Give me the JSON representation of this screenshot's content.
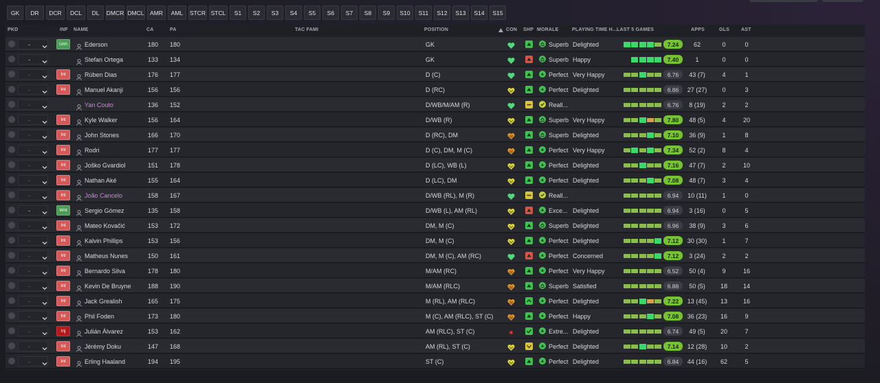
{
  "position_filters": [
    "GK",
    "DR",
    "DCR",
    "DCL",
    "DL",
    "DMCR",
    "DMCL",
    "AMR",
    "AML",
    "STCR",
    "STCL",
    "S1",
    "S2",
    "S3",
    "S4",
    "S5",
    "S6",
    "S7",
    "S8",
    "S9",
    "S10",
    "S11",
    "S12",
    "S13",
    "S14",
    "S15"
  ],
  "columns": {
    "pkd": "PKD",
    "inf": "INF",
    "name": "NAME",
    "ca": "CA",
    "pa": "PA",
    "tac": "TAC FAMI",
    "position": "POSITION",
    "sort_icon": "sort-ascending-icon",
    "con": "CON",
    "shp": "SHP",
    "morale": "MORALE",
    "playing_time": "PLAYING TIME H...",
    "last5": "LAST 5 GAMES",
    "apps": "APPS",
    "gls": "GLS",
    "ast": "AST"
  },
  "colors": {
    "accent_green": "#76c331",
    "heart_green": "#4fd97a",
    "heart_yellow": "#d8d43a",
    "heart_orange": "#e0962e",
    "int_red": "#d45a5a",
    "loan_purple": "#c88bd2"
  },
  "players": [
    {
      "pkd": "-",
      "inf": "Unh",
      "name": "Ederson",
      "loan": false,
      "ca": "180",
      "pa": "180",
      "position": "GK",
      "con": "green",
      "shp": "green",
      "shp_icon": "up",
      "morale_level": "superb",
      "morale": "Superb",
      "playing_time": "Delighted",
      "last5": [
        2,
        2,
        2,
        2,
        1
      ],
      "rating": "7.24",
      "rating_hi": true,
      "apps": "62",
      "gls": "0",
      "ast": "0"
    },
    {
      "pkd": "-",
      "inf": "",
      "name": "Stefan Ortega",
      "loan": false,
      "ca": "133",
      "pa": "134",
      "position": "GK",
      "con": "green",
      "shp": "red",
      "shp_icon": "up",
      "morale_level": "superb",
      "morale": "Superb",
      "playing_time": "Happy",
      "last5": [
        0,
        2,
        2,
        2,
        2
      ],
      "rating": "7.40",
      "rating_hi": true,
      "apps": "1",
      "gls": "0",
      "ast": "0"
    },
    {
      "pkd": "-",
      "inf": "Int",
      "name": "Rúben Dias",
      "loan": false,
      "ca": "176",
      "pa": "177",
      "position": "D (C)",
      "con": "green",
      "shp": "green",
      "shp_icon": "up",
      "morale_level": "perfect",
      "morale": "Perfect",
      "playing_time": "Very Happy",
      "last5": [
        1,
        1,
        2,
        1,
        1
      ],
      "rating": "6.76",
      "rating_hi": false,
      "apps": "43 (7)",
      "gls": "4",
      "ast": "1"
    },
    {
      "pkd": "-",
      "inf": "Int",
      "name": "Manuel Akanji",
      "loan": false,
      "ca": "156",
      "pa": "156",
      "position": "D (RC)",
      "con": "yellow",
      "shp": "green",
      "shp_icon": "up",
      "morale_level": "perfect",
      "morale": "Perfect",
      "playing_time": "Delighted",
      "last5": [
        1,
        1,
        1,
        1,
        1
      ],
      "rating": "6.86",
      "rating_hi": false,
      "apps": "27 (27)",
      "gls": "0",
      "ast": "3"
    },
    {
      "pkd": "-",
      "inf": "",
      "name": "Yan Couto",
      "loan": true,
      "ca": "136",
      "pa": "152",
      "position": "D/WB/M/AM (R)",
      "con": "green",
      "shp": "yellow",
      "shp_icon": "dash",
      "morale_level": "good",
      "morale": "Reall...",
      "playing_time": "",
      "last5": [
        1,
        1,
        1,
        1,
        1
      ],
      "rating": "6.76",
      "rating_hi": false,
      "apps": "8 (19)",
      "gls": "2",
      "ast": "2"
    },
    {
      "pkd": "-",
      "inf": "Int",
      "name": "Kyle Walker",
      "loan": false,
      "ca": "156",
      "pa": "164",
      "position": "D/WB (R)",
      "con": "yellow",
      "shp": "green",
      "shp_icon": "up",
      "morale_level": "superb",
      "morale": "Superb",
      "playing_time": "Very Happy",
      "last5": [
        1,
        1,
        2,
        3,
        1
      ],
      "rating": "7.80",
      "rating_hi": true,
      "apps": "48 (5)",
      "gls": "4",
      "ast": "20"
    },
    {
      "pkd": "-",
      "inf": "Int",
      "name": "John Stones",
      "loan": false,
      "ca": "166",
      "pa": "170",
      "position": "D (RC), DM",
      "con": "orange",
      "shp": "green",
      "shp_icon": "up",
      "morale_level": "superb",
      "morale": "Superb",
      "playing_time": "Delighted",
      "last5": [
        1,
        1,
        1,
        2,
        1
      ],
      "rating": "7.10",
      "rating_hi": true,
      "apps": "36 (9)",
      "gls": "1",
      "ast": "8"
    },
    {
      "pkd": "-",
      "inf": "Int",
      "name": "Rodri",
      "loan": false,
      "ca": "177",
      "pa": "177",
      "position": "D (C), DM, M (C)",
      "con": "orange",
      "shp": "green",
      "shp_icon": "up",
      "morale_level": "perfect",
      "morale": "Perfect",
      "playing_time": "Very Happy",
      "last5": [
        1,
        2,
        1,
        2,
        1
      ],
      "rating": "7.34",
      "rating_hi": true,
      "apps": "52 (2)",
      "gls": "8",
      "ast": "4"
    },
    {
      "pkd": "-",
      "inf": "Int",
      "name": "Joško Gvardiol",
      "loan": false,
      "ca": "151",
      "pa": "178",
      "position": "D (LC), WB (L)",
      "con": "yellow",
      "shp": "green",
      "shp_icon": "up",
      "morale_level": "perfect",
      "morale": "Perfect",
      "playing_time": "Delighted",
      "last5": [
        1,
        1,
        2,
        1,
        1
      ],
      "rating": "7.16",
      "rating_hi": true,
      "apps": "47 (7)",
      "gls": "2",
      "ast": "10"
    },
    {
      "pkd": "-",
      "inf": "Int",
      "name": "Nathan Aké",
      "loan": false,
      "ca": "155",
      "pa": "164",
      "position": "D (LC), DM",
      "con": "yellow",
      "shp": "green",
      "shp_icon": "up",
      "morale_level": "perfect",
      "morale": "Perfect",
      "playing_time": "Delighted",
      "last5": [
        1,
        1,
        1,
        2,
        1
      ],
      "rating": "7.08",
      "rating_hi": true,
      "apps": "48 (7)",
      "gls": "3",
      "ast": "4"
    },
    {
      "pkd": "-",
      "inf": "Int",
      "name": "João Cancelo",
      "loan": true,
      "ca": "158",
      "pa": "167",
      "position": "D/WB (RL), M (R)",
      "con": "green",
      "shp": "yellow",
      "shp_icon": "dash",
      "morale_level": "good",
      "morale": "Reall...",
      "playing_time": "",
      "last5": [
        1,
        1,
        1,
        1,
        1
      ],
      "rating": "6.94",
      "rating_hi": false,
      "apps": "10 (11)",
      "gls": "1",
      "ast": "0"
    },
    {
      "pkd": "-",
      "inf": "Wnt",
      "name": "Sergio Gómez",
      "loan": false,
      "ca": "135",
      "pa": "158",
      "position": "D/WB (L), AM (RL)",
      "con": "yellow",
      "shp": "red",
      "shp_icon": "up",
      "morale_level": "perfect",
      "morale": "Exce...",
      "playing_time": "Delighted",
      "last5": [
        1,
        1,
        1,
        1,
        1
      ],
      "rating": "6.94",
      "rating_hi": false,
      "apps": "3 (16)",
      "gls": "0",
      "ast": "5"
    },
    {
      "pkd": "-",
      "inf": "Int",
      "name": "Mateo Kovačić",
      "loan": false,
      "ca": "153",
      "pa": "172",
      "position": "DM, M (C)",
      "con": "yellow",
      "shp": "green",
      "shp_icon": "up",
      "morale_level": "superb",
      "morale": "Superb",
      "playing_time": "Delighted",
      "last5": [
        1,
        1,
        1,
        1,
        1
      ],
      "rating": "6.96",
      "rating_hi": false,
      "apps": "38 (9)",
      "gls": "3",
      "ast": "6"
    },
    {
      "pkd": "-",
      "inf": "Int",
      "name": "Kalvin Phillips",
      "loan": false,
      "ca": "153",
      "pa": "156",
      "position": "DM, M (C)",
      "con": "yellow",
      "shp": "green",
      "shp_icon": "up",
      "morale_level": "perfect",
      "morale": "Perfect",
      "playing_time": "Delighted",
      "last5": [
        1,
        1,
        1,
        1,
        2
      ],
      "rating": "7.12",
      "rating_hi": true,
      "apps": "30 (30)",
      "gls": "1",
      "ast": "7"
    },
    {
      "pkd": "-",
      "inf": "Int",
      "name": "Matheus Nunes",
      "loan": false,
      "ca": "150",
      "pa": "161",
      "position": "DM, M (C), AM (RC)",
      "con": "green",
      "shp": "red",
      "shp_icon": "up",
      "morale_level": "perfect",
      "morale": "Perfect",
      "playing_time": "Concerned",
      "last5": [
        1,
        1,
        1,
        1,
        2
      ],
      "rating": "7.12",
      "rating_hi": true,
      "apps": "3 (24)",
      "gls": "2",
      "ast": "2"
    },
    {
      "pkd": "-",
      "inf": "Int",
      "name": "Bernardo Silva",
      "loan": false,
      "ca": "178",
      "pa": "180",
      "position": "M/AM (RC)",
      "con": "orange",
      "shp": "green",
      "shp_icon": "up",
      "morale_level": "perfect",
      "morale": "Perfect",
      "playing_time": "Very Happy",
      "last5": [
        1,
        1,
        1,
        1,
        1
      ],
      "rating": "6.52",
      "rating_hi": false,
      "apps": "50 (4)",
      "gls": "9",
      "ast": "16"
    },
    {
      "pkd": "-",
      "inf": "Int",
      "name": "Kevin De Bruyne",
      "loan": false,
      "ca": "188",
      "pa": "190",
      "position": "M/AM (RLC)",
      "con": "orange",
      "shp": "green",
      "shp_icon": "up",
      "morale_level": "superb",
      "morale": "Superb",
      "playing_time": "Satisfied",
      "last5": [
        1,
        1,
        1,
        1,
        1
      ],
      "rating": "6.88",
      "rating_hi": false,
      "apps": "50 (5)",
      "gls": "18",
      "ast": "14"
    },
    {
      "pkd": "-",
      "inf": "Int",
      "name": "Jack Grealish",
      "loan": false,
      "ca": "165",
      "pa": "175",
      "position": "M (RL), AM (RLC)",
      "con": "orange",
      "shp": "green",
      "shp_icon": "caret",
      "morale_level": "perfect",
      "morale": "Perfect",
      "playing_time": "Delighted",
      "last5": [
        1,
        1,
        2,
        3,
        1
      ],
      "rating": "7.22",
      "rating_hi": true,
      "apps": "13 (45)",
      "gls": "13",
      "ast": "16"
    },
    {
      "pkd": "-",
      "inf": "Int",
      "name": "Phil Foden",
      "loan": false,
      "ca": "173",
      "pa": "180",
      "position": "M (C), AM (RLC), ST (C)",
      "con": "orange",
      "shp": "green",
      "shp_icon": "up",
      "morale_level": "perfect",
      "morale": "Perfect",
      "playing_time": "Happy",
      "last5": [
        1,
        1,
        1,
        2,
        1
      ],
      "rating": "7.08",
      "rating_hi": true,
      "apps": "36 (23)",
      "gls": "16",
      "ast": "9"
    },
    {
      "pkd": "-",
      "inf": "Inj",
      "name": "Julián Álvarez",
      "loan": false,
      "ca": "153",
      "pa": "162",
      "position": "AM (RLC), ST (C)",
      "con": "injury",
      "shp": "green",
      "shp_icon": "check",
      "morale_level": "perfect",
      "morale": "Extre...",
      "playing_time": "Delighted",
      "last5": [
        1,
        1,
        1,
        1,
        1
      ],
      "rating": "6.74",
      "rating_hi": false,
      "apps": "49 (5)",
      "gls": "20",
      "ast": "7"
    },
    {
      "pkd": "-",
      "inf": "Int",
      "name": "Jérémy Doku",
      "loan": false,
      "ca": "147",
      "pa": "168",
      "position": "AM (RL), ST (C)",
      "con": "yellow",
      "shp": "yellow",
      "shp_icon": "down",
      "morale_level": "perfect",
      "morale": "Perfect",
      "playing_time": "Delighted",
      "last5": [
        1,
        1,
        2,
        1,
        1
      ],
      "rating": "7.14",
      "rating_hi": true,
      "apps": "12 (28)",
      "gls": "10",
      "ast": "2"
    },
    {
      "pkd": "-",
      "inf": "Int",
      "name": "Erling Haaland",
      "loan": false,
      "ca": "194",
      "pa": "195",
      "position": "ST (C)",
      "con": "yellow",
      "shp": "green",
      "shp_icon": "up",
      "morale_level": "perfect",
      "morale": "Perfect",
      "playing_time": "Delighted",
      "last5": [
        1,
        1,
        1,
        1,
        1
      ],
      "rating": "6.84",
      "rating_hi": false,
      "apps": "44 (16)",
      "gls": "62",
      "ast": "5"
    }
  ]
}
